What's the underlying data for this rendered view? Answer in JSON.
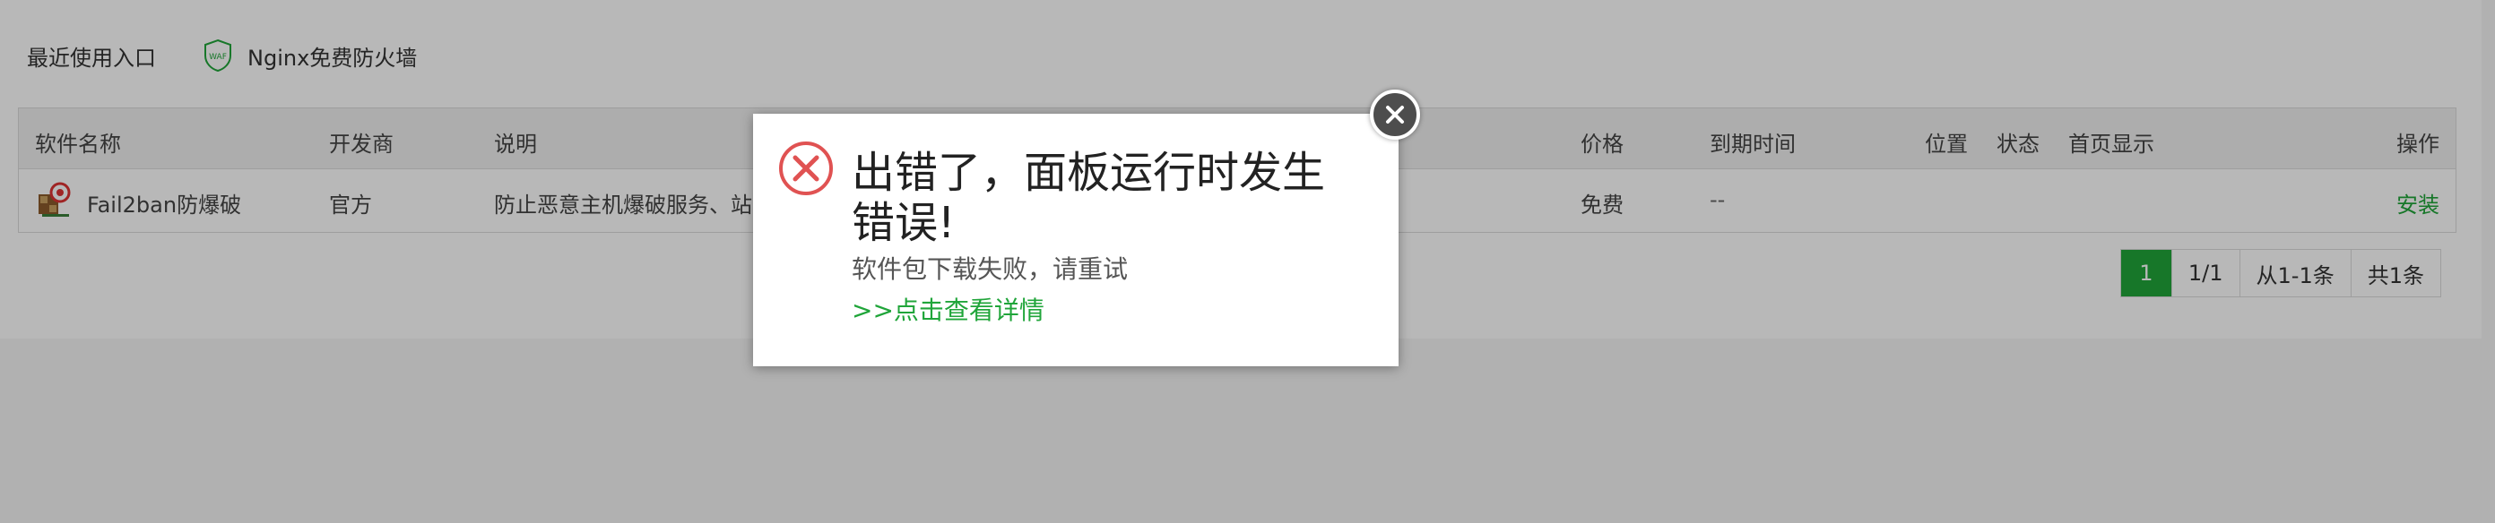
{
  "recent": {
    "label": "最近使用入口",
    "items": [
      {
        "label": "Nginx免费防火墙",
        "icon": "waf-shield-icon",
        "icon_text": "WAF"
      }
    ]
  },
  "table": {
    "headers": {
      "name": "软件名称",
      "developer": "开发商",
      "description": "说明",
      "price": "价格",
      "expire": "到期时间",
      "location": "位置",
      "status": "状态",
      "homepage": "首页显示",
      "actions": "操作"
    },
    "rows": [
      {
        "name": "Fail2ban防爆破",
        "developer": "官方",
        "description": "防止恶意主机爆破服务、站",
        "price": "免费",
        "expire": "--",
        "action": "安装"
      }
    ]
  },
  "pagination": {
    "current": "1",
    "pages": "1/1",
    "range": "从1-1条",
    "total": "共1条"
  },
  "dialog": {
    "title": "出错了，面板运行时发生错误!",
    "message": "软件包下载失败，请重试",
    "detail_link": ">>点击查看详情"
  },
  "colors": {
    "accent": "#20a53a",
    "error": "#e05252",
    "close": "#4d4d4d"
  }
}
